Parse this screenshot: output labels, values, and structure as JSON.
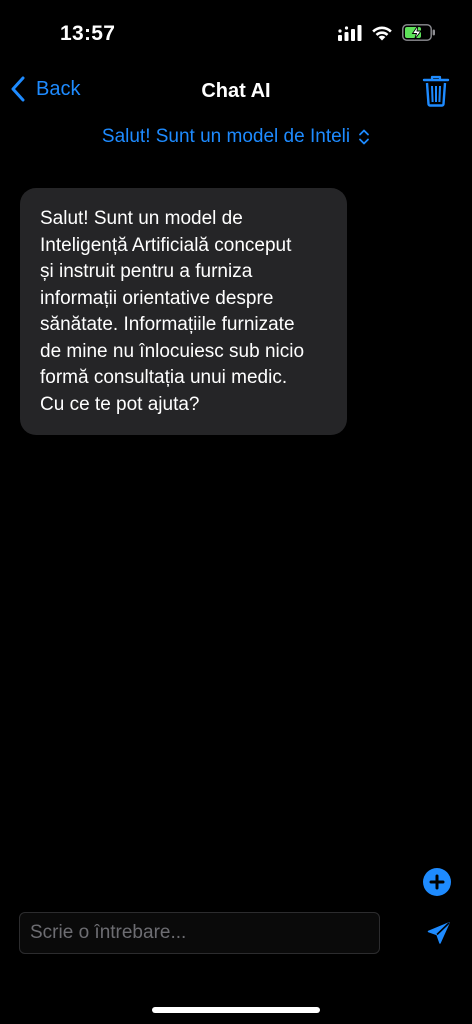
{
  "status_bar": {
    "time": "13:57",
    "icons": [
      "cellular-signal-icon",
      "wifi-icon",
      "battery-charging-icon"
    ]
  },
  "nav": {
    "back_label": "Back",
    "title": "Chat AI",
    "trash_icon": "trash-icon"
  },
  "model_selector": {
    "label": "Salut! Sunt un model de Inteli",
    "icon": "chevron-up-down-icon"
  },
  "messages": [
    {
      "role": "assistant",
      "lines": [
        "Salut! Sunt un model de",
        "Inteligență Artificială conceput",
        "și instruit pentru a furniza",
        "informații orientative despre",
        "sănătate. Informațiile furnizate",
        "de mine nu înlocuiesc sub nicio",
        "formă consultația unui medic.",
        "Cu ce te pot ajuta?"
      ]
    }
  ],
  "composer": {
    "placeholder": "Scrie o întrebare...",
    "value": "",
    "add_icon": "plus-circle-icon",
    "send_icon": "send-icon"
  },
  "colors": {
    "accent": "#1e8bff",
    "background": "#000000",
    "bubble": "#252527",
    "battery_fill": "#5ee25a"
  }
}
